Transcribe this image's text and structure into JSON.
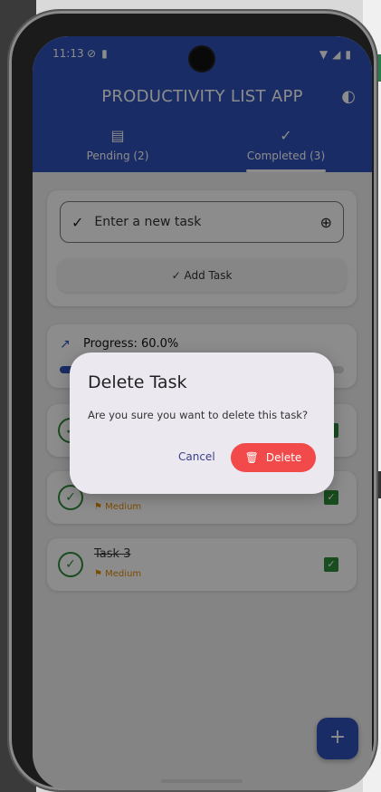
{
  "status_bar": {
    "time": "11:13"
  },
  "app": {
    "title": "PRODUCTIVITY LIST APP"
  },
  "tabs": [
    {
      "label": "Pending (2)",
      "icon": "clipboard-icon",
      "selected": false
    },
    {
      "label": "Completed (3)",
      "icon": "check-circle-icon",
      "selected": true
    }
  ],
  "task_input": {
    "placeholder": "Enter a new task"
  },
  "add_task": {
    "label": "Add Task"
  },
  "progress": {
    "label": "Progress: 60.0%",
    "fraction": 0.6
  },
  "tasks": [
    {
      "name": "",
      "priority": ""
    },
    {
      "name": "",
      "priority": "Medium"
    },
    {
      "name": "Task 3",
      "priority": "Medium"
    }
  ],
  "dialog": {
    "title": "Delete Task",
    "message": "Are you sure you want to delete this task?",
    "cancel_label": "Cancel",
    "delete_label": "Delete"
  },
  "colors": {
    "primary": "#2f50b8",
    "success": "#2e8b3a",
    "priority_medium": "#e08a00",
    "danger": "#f24a4a"
  }
}
